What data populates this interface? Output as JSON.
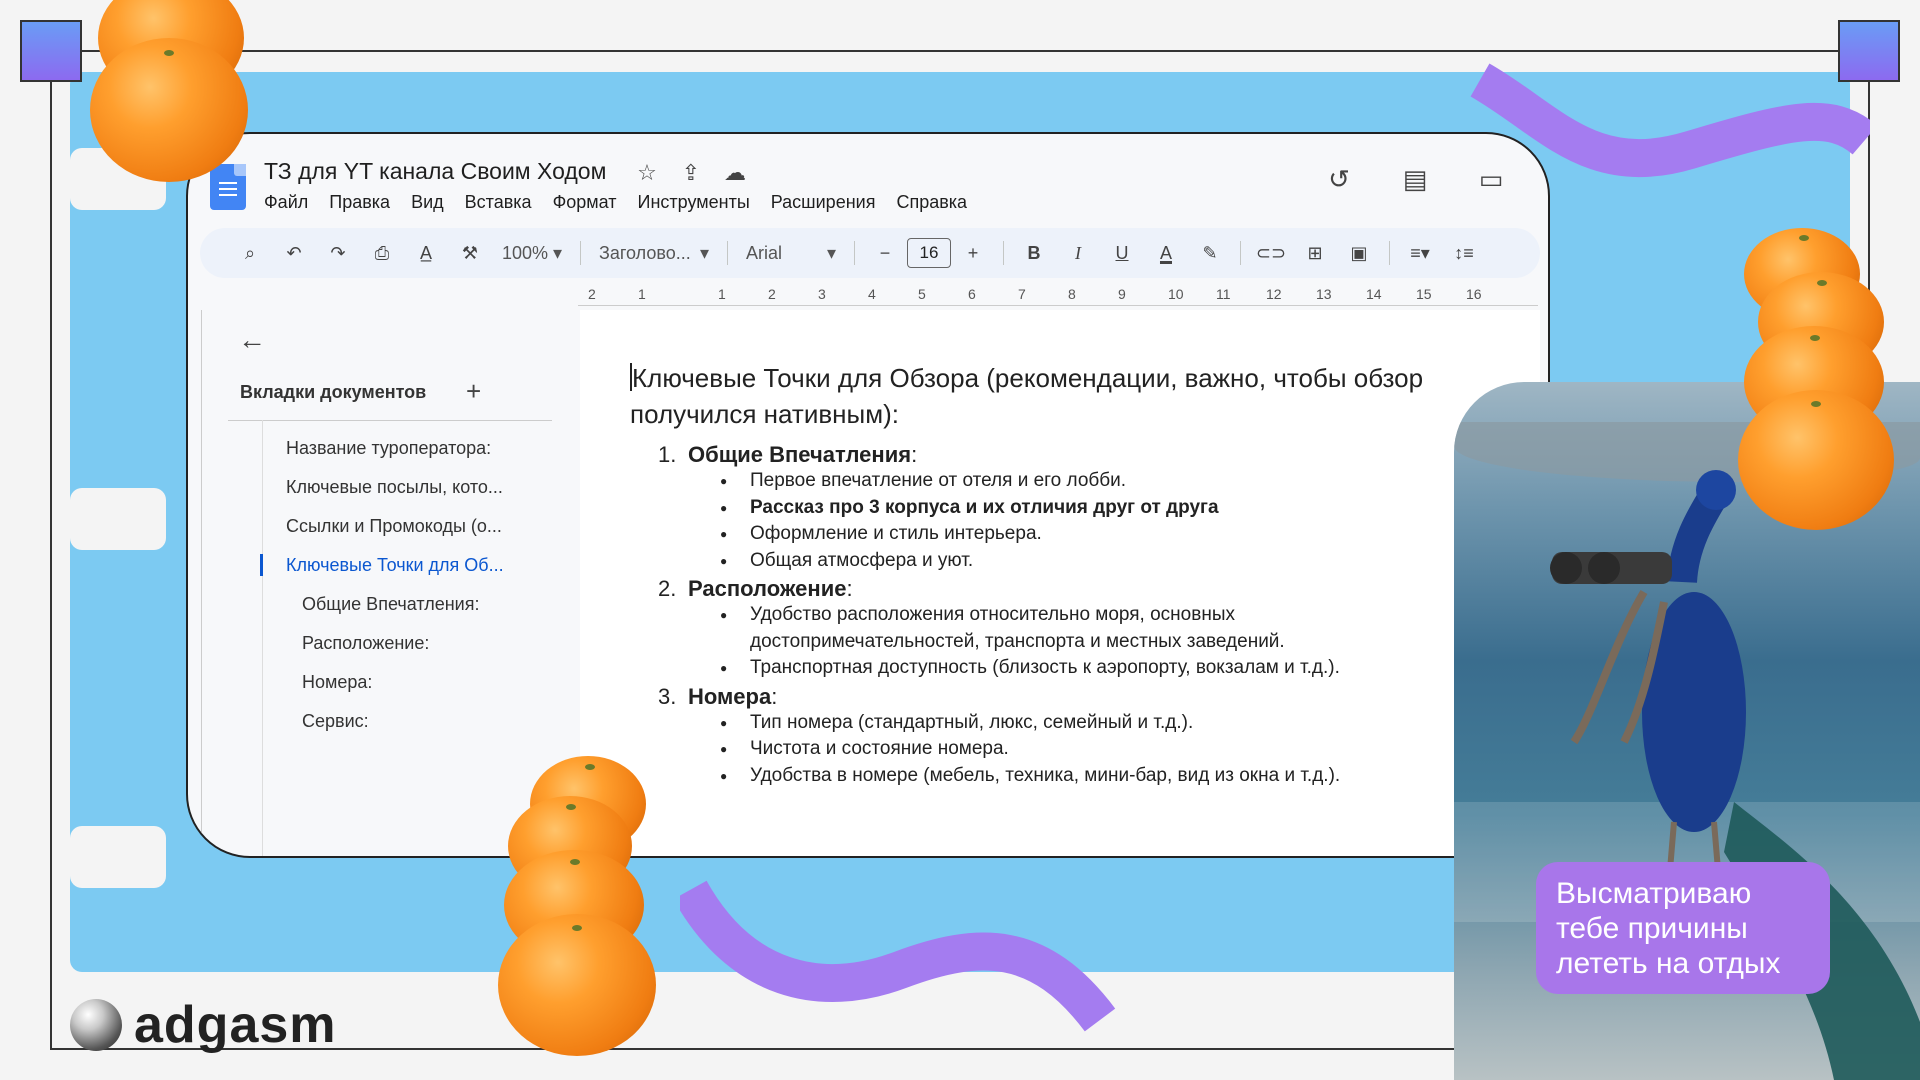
{
  "doc": {
    "title": "ТЗ для YT канала Своим Ходом",
    "title_icons": [
      "star-icon",
      "drive-move-icon",
      "cloud-status-icon"
    ],
    "menu": [
      "Файл",
      "Правка",
      "Вид",
      "Вставка",
      "Формат",
      "Инструменты",
      "Расширения",
      "Справка"
    ],
    "right_icons": [
      "history-icon",
      "comments-icon",
      "meet-icon"
    ]
  },
  "toolbar": {
    "zoom": "100%",
    "style": "Заголово...",
    "font": "Arial",
    "font_size": "16",
    "minus": "−",
    "plus": "+"
  },
  "ruler": [
    "2",
    "1",
    "1",
    "2",
    "3",
    "4",
    "5",
    "6",
    "7",
    "8",
    "9",
    "10",
    "11",
    "12",
    "13",
    "14",
    "15",
    "16"
  ],
  "sidebar": {
    "heading": "Вкладки документов",
    "add": "+",
    "items": [
      {
        "label": "Название туроператора:"
      },
      {
        "label": "Ключевые посылы, кото..."
      },
      {
        "label": "Ссылки и Промокоды (о..."
      },
      {
        "label": "Ключевые Точки для Об..."
      }
    ],
    "subitems": [
      {
        "label": "Общие Впечатления:"
      },
      {
        "label": "Расположение:"
      },
      {
        "label": "Номера:"
      },
      {
        "label": "Сервис:"
      }
    ]
  },
  "content": {
    "heading": "Ключевые Точки для Обзора (рекомендации, важно, чтобы обзор получился нативным):",
    "sections": [
      {
        "num": "1.",
        "title": "Общие Впечатления",
        "colon": ":",
        "bullets": [
          "Первое впечатление от отеля и его лобби.",
          "Рассказ про 3 корпуса и их отличия друг от друга",
          "Оформление и стиль интерьера.",
          "Общая атмосфера и уют."
        ]
      },
      {
        "num": "2.",
        "title": "Расположение",
        "colon": ":",
        "bullets": [
          "Удобство расположения относительно моря, основных достопримечательностей, транспорта и местных заведений.",
          "Транспортная доступность (близость к аэропорту, вокзалам и т.д.)."
        ]
      },
      {
        "num": "3.",
        "title": "Номера",
        "colon": ":",
        "bullets": [
          "Тип номера (стандартный, люкс, семейный и т.д.).",
          "Чистота и состояние номера.",
          "Удобства в номере (мебель, техника, мини-бар, вид из окна и т.д.)."
        ]
      }
    ]
  },
  "caption": "Высматриваю тебе причины лететь на отдых",
  "brand": "adgasm",
  "colors": {
    "panel_blue": "#7ccaf2",
    "accent_purple": "#a876ea",
    "link_blue": "#0b57d0"
  }
}
